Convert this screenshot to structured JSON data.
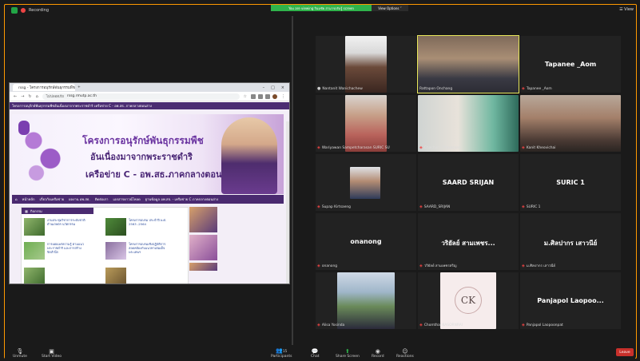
{
  "topbar": {
    "recording": "Recording",
    "share_banner": "You are viewing รินบชัย สามารถรับรู้ screen",
    "view_options": "View Options ˅",
    "view": "☰ View"
  },
  "browser": {
    "tab_title": "rssg - โครงการอนุรักษ์พันธุกรรมพืช",
    "url_security": "ไม่ปลอดภัย",
    "url": "rssg.rmutp.ac.th",
    "site_bar": "โครงการอนุรักษ์พันธุกรรมพืชอันเนื่องมาจากพระราชดำริ เครือข่าย C - อพ.สธ. ภาคกลางตอนล่าง",
    "banner_line1": "โครงการอนุรักษ์พันธุกรรมพืช",
    "banner_line2": "อันเนื่องมาจากพระราชดำริ",
    "banner_line3": "เครือข่าย C - อพ.สธ.ภาคกลางตอนล่าง",
    "nav": [
      "หน้าหลัก",
      "เกี่ยวกับเครือข่าย",
      "ผลงาน อพ.สธ.",
      "ติดต่อเรา",
      "เอกสารดาวน์โหลด",
      "ฐานข้อมูล อพ.สธ. - เครือข่าย C ภาคกลางตอนล่าง"
    ],
    "activities_header": "กิจกรรม",
    "news": [
      "งานประชุมวิชาการระดับชาติ ด้านเกษตร นวัตกรรม",
      "โครงการอบรม ประจำปี พ.ศ. 2563 -2564",
      "การเผยแพร่ความรู้ ตามแนวพระราชดำริ และการสร้างจิตสำนึก",
      "โครงการอบรมเชิงปฏิบัติการ สอดคล้องกับแนวทางสมเด็จพระเทพฯ"
    ]
  },
  "participants": [
    {
      "name": "Nantanit Wanichachew",
      "display": "",
      "muted": false
    },
    {
      "name": "Rattapon Onchang",
      "display": "",
      "muted": true
    },
    {
      "name": "Tapanee _Aom",
      "display": "Tapanee _Aom",
      "muted": true
    },
    {
      "name": "Wariyawan Sampetcharasan SURIC SU",
      "display": "",
      "muted": true
    },
    {
      "name": "Chacharn Thavaraan",
      "display": "",
      "muted": true
    },
    {
      "name": "Kanit Kheovichai",
      "display": "",
      "muted": true
    },
    {
      "name": "Supap Kirtsaeng",
      "display": "",
      "muted": true
    },
    {
      "name": "SAARD_SRIJAN",
      "display": "SAARD  SRIJAN",
      "muted": true
    },
    {
      "name": "SURIC 1",
      "display": "SURIC 1",
      "muted": true
    },
    {
      "name": "onanong",
      "display": "onanong",
      "muted": true
    },
    {
      "name": "วริยัลย์ สามเพชรสริญ",
      "display": "วริยัลย์ สามเพชร...",
      "muted": true
    },
    {
      "name": "ม.ศิลปากร เสาวนีย์",
      "display": "ม.ศิลปากร เสาวนีย์",
      "muted": true
    },
    {
      "name": "Alisa Yosinda",
      "display": "",
      "muted": true
    },
    {
      "name": "Chomthai KASORNRAI",
      "display": "",
      "muted": true
    },
    {
      "name": "Panjapol Laopoonpat",
      "display": "Panjapol  Laopoo...",
      "muted": true
    }
  ],
  "toolbar": {
    "unmute": "Unmute",
    "start_video": "Start Video",
    "participants": "Participants",
    "participants_count": "15",
    "chat": "Chat",
    "share_screen": "Share Screen",
    "record": "Record",
    "reactions": "Reactions",
    "leave": "Leave"
  },
  "colors": {
    "share_green": "#2fb34b",
    "leave_red": "#c8302b",
    "site_purple": "#4a2a70",
    "active_speaker": "#e9e95a"
  }
}
